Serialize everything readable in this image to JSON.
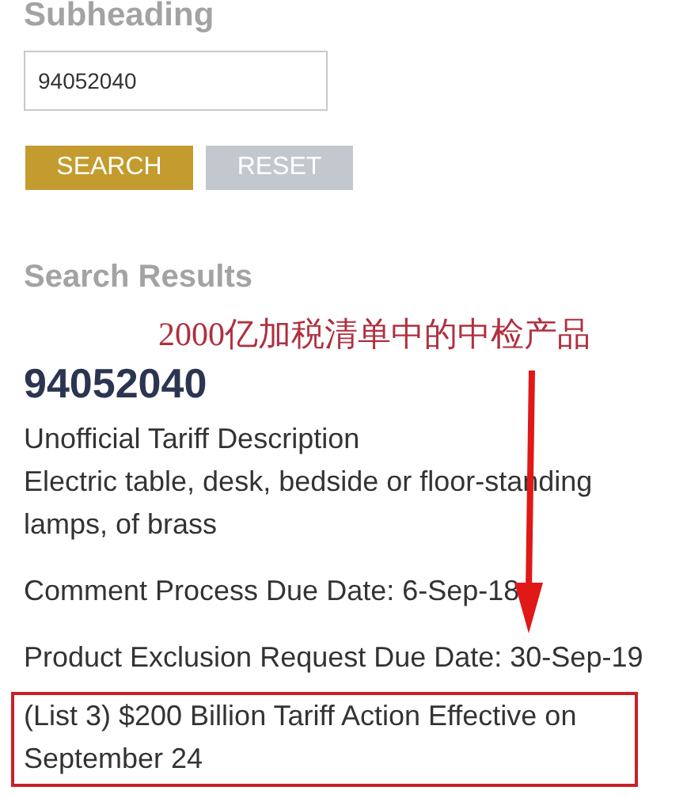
{
  "subheading": "Subheading",
  "search": {
    "value": "94052040"
  },
  "buttons": [
    {
      "label": "SEARCH",
      "kind": "primary"
    },
    {
      "label": "RESET",
      "kind": "secondary"
    }
  ],
  "results_heading": "Search Results",
  "annotation": "2000亿加税清单中的中检产品",
  "result": {
    "code": "94052040",
    "lines": [
      "Unofficial Tariff Description",
      "Electric table, desk, bedside or floor-standing lamps, of brass",
      "Comment Process Due Date: 6-Sep-18",
      "Product Exclusion Request Due Date: 30-Sep-19"
    ],
    "highlight": "(List 3) $200 Billion Tariff Action Effective on September 24"
  }
}
